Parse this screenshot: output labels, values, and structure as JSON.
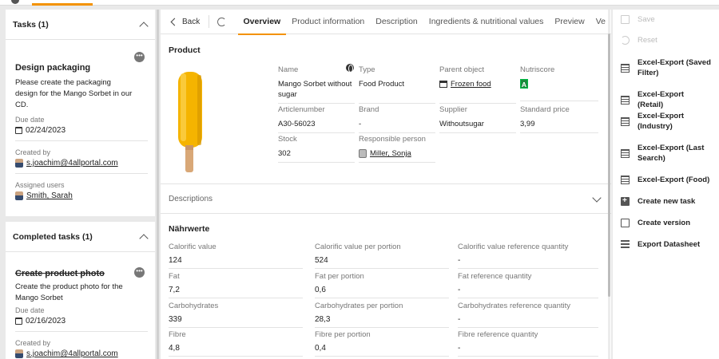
{
  "tasks_panel": {
    "title": "Tasks (1)",
    "task": {
      "title": "Design packaging",
      "description": "Please create the packaging design for the Mango Sorbet in our CD.",
      "due_label": "Due date",
      "due_value": "02/24/2023",
      "created_label": "Created by",
      "created_value": "s.joachim@4allportal.com",
      "assigned_label": "Assigned users",
      "assigned_value": "Smith, Sarah"
    }
  },
  "completed_panel": {
    "title": "Completed tasks (1)",
    "task": {
      "title": "Create product photo",
      "description": "Create the product photo for the Mango Sorbet",
      "due_label": "Due date",
      "due_value": "02/16/2023",
      "created_label": "Created by",
      "created_value": "s.joachim@4allportal.com"
    }
  },
  "toolbar": {
    "back_label": "Back",
    "tabs": [
      "Overview",
      "Product information",
      "Description",
      "Ingredients & nutritional values",
      "Preview",
      "Ve"
    ]
  },
  "product": {
    "section_title": "Product",
    "name_label": "Name",
    "name_value": "Mango Sorbet without sugar",
    "type_label": "Type",
    "type_value": "Food Product",
    "parent_label": "Parent object",
    "parent_value": "Frozen food",
    "nutriscore_label": "Nutriscore",
    "nutriscore_value": "A",
    "article_label": "Articlenumber",
    "article_value": "A30-56023",
    "brand_label": "Brand",
    "brand_value": "-",
    "supplier_label": "Supplier",
    "supplier_value": "Withoutsugar",
    "price_label": "Standard price",
    "price_value": "3,99",
    "stock_label": "Stock",
    "stock_value": "302",
    "responsible_label": "Responsible person",
    "responsible_value": "Miller, Sonja"
  },
  "descriptions": {
    "label": "Descriptions"
  },
  "nutrition": {
    "title": "Nährwerte",
    "rows": [
      [
        {
          "label": "Calorific value",
          "value": "124"
        },
        {
          "label": "Calorific value per portion",
          "value": "524"
        },
        {
          "label": "Calorific value reference quantity",
          "value": "-"
        }
      ],
      [
        {
          "label": "Fat",
          "value": "7,2"
        },
        {
          "label": "Fat per portion",
          "value": "0,6"
        },
        {
          "label": "Fat reference quantity",
          "value": "-"
        }
      ],
      [
        {
          "label": "Carbohydrates",
          "value": "339"
        },
        {
          "label": "Carbohydrates per portion",
          "value": "28,3"
        },
        {
          "label": "Carbohydrates reference quantity",
          "value": "-"
        }
      ],
      [
        {
          "label": "Fibre",
          "value": "4,8"
        },
        {
          "label": "Fibre per portion",
          "value": "0,4"
        },
        {
          "label": "Fibre reference quantity",
          "value": "-"
        }
      ]
    ]
  },
  "actions": [
    {
      "label": "Save",
      "icon": "save-icon",
      "enabled": false
    },
    {
      "label": "Reset",
      "icon": "reset-icon",
      "enabled": false
    },
    {
      "label": "Excel-Export (Saved Filter)",
      "icon": "table-icon",
      "enabled": true
    },
    {
      "label": "Excel-Export (Retail)",
      "icon": "table-icon",
      "enabled": true
    },
    {
      "label": "Excel-Export (Industry)",
      "icon": "table-icon",
      "enabled": true
    },
    {
      "label": "Excel-Export (Last Search)",
      "icon": "table-icon",
      "enabled": true
    },
    {
      "label": "Excel-Export (Food)",
      "icon": "table-icon",
      "enabled": true
    },
    {
      "label": "Create new task",
      "icon": "add-task-icon",
      "enabled": true
    },
    {
      "label": "Create version",
      "icon": "version-icon",
      "enabled": true
    },
    {
      "label": "Export Datasheet",
      "icon": "datasheet-icon",
      "enabled": true
    }
  ],
  "colors": {
    "accent": "#f39200",
    "nutriscore_a": "#1b8a3c",
    "popsicle": "#f5b400"
  }
}
